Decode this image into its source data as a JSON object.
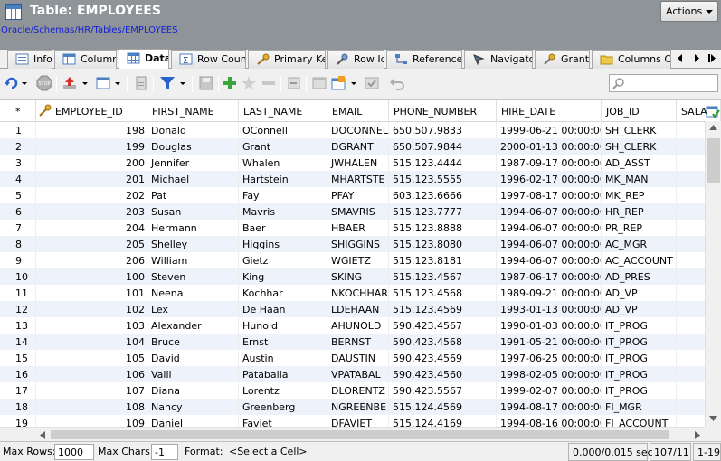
{
  "window": {
    "title": "Table: EMPLOYEES",
    "breadcrumb": "Oracle/Schemas/HR/Tables/EMPLOYEES",
    "actions_label": "Actions"
  },
  "tabs": [
    {
      "label": "Info",
      "icon": "info-icon"
    },
    {
      "label": "Columns",
      "icon": "columns-icon"
    },
    {
      "label": "Data",
      "icon": "data-grid-icon",
      "active": true
    },
    {
      "label": "Row Count",
      "icon": "sigma-icon"
    },
    {
      "label": "Primary Key",
      "icon": "key-icon"
    },
    {
      "label": "Row Id",
      "icon": "pin-icon"
    },
    {
      "label": "References",
      "icon": "references-icon"
    },
    {
      "label": "Navigator",
      "icon": "navigator-icon"
    },
    {
      "label": "Grants",
      "icon": "grants-icon"
    },
    {
      "label": "Columns Com",
      "icon": "folder-icon"
    }
  ],
  "toolbar": {
    "search_placeholder": ""
  },
  "grid": {
    "columns": [
      "*",
      "EMPLOYEE_ID",
      "FIRST_NAME",
      "LAST_NAME",
      "EMAIL",
      "PHONE_NUMBER",
      "HIRE_DATE",
      "JOB_ID",
      "SALA"
    ],
    "rows": [
      [
        "1",
        "198",
        "Donald",
        "OConnell",
        "DOCONNEL",
        "650.507.9833",
        "1999-06-21 00:00:00",
        "SH_CLERK"
      ],
      [
        "2",
        "199",
        "Douglas",
        "Grant",
        "DGRANT",
        "650.507.9844",
        "2000-01-13 00:00:00",
        "SH_CLERK"
      ],
      [
        "3",
        "200",
        "Jennifer",
        "Whalen",
        "JWHALEN",
        "515.123.4444",
        "1987-09-17 00:00:00",
        "AD_ASST"
      ],
      [
        "4",
        "201",
        "Michael",
        "Hartstein",
        "MHARTSTE",
        "515.123.5555",
        "1996-02-17 00:00:00",
        "MK_MAN"
      ],
      [
        "5",
        "202",
        "Pat",
        "Fay",
        "PFAY",
        "603.123.6666",
        "1997-08-17 00:00:00",
        "MK_REP"
      ],
      [
        "6",
        "203",
        "Susan",
        "Mavris",
        "SMAVRIS",
        "515.123.7777",
        "1994-06-07 00:00:00",
        "HR_REP"
      ],
      [
        "7",
        "204",
        "Hermann",
        "Baer",
        "HBAER",
        "515.123.8888",
        "1994-06-07 00:00:00",
        "PR_REP"
      ],
      [
        "8",
        "205",
        "Shelley",
        "Higgins",
        "SHIGGINS",
        "515.123.8080",
        "1994-06-07 00:00:00",
        "AC_MGR"
      ],
      [
        "9",
        "206",
        "William",
        "Gietz",
        "WGIETZ",
        "515.123.8181",
        "1994-06-07 00:00:00",
        "AC_ACCOUNT"
      ],
      [
        "10",
        "100",
        "Steven",
        "King",
        "SKING",
        "515.123.4567",
        "1987-06-17 00:00:00",
        "AD_PRES"
      ],
      [
        "11",
        "101",
        "Neena",
        "Kochhar",
        "NKOCHHAR",
        "515.123.4568",
        "1989-09-21 00:00:00",
        "AD_VP"
      ],
      [
        "12",
        "102",
        "Lex",
        "De Haan",
        "LDEHAAN",
        "515.123.4569",
        "1993-01-13 00:00:00",
        "AD_VP"
      ],
      [
        "13",
        "103",
        "Alexander",
        "Hunold",
        "AHUNOLD",
        "590.423.4567",
        "1990-01-03 00:00:00",
        "IT_PROG"
      ],
      [
        "14",
        "104",
        "Bruce",
        "Ernst",
        "BERNST",
        "590.423.4568",
        "1991-05-21 00:00:00",
        "IT_PROG"
      ],
      [
        "15",
        "105",
        "David",
        "Austin",
        "DAUSTIN",
        "590.423.4569",
        "1997-06-25 00:00:00",
        "IT_PROG"
      ],
      [
        "16",
        "106",
        "Valli",
        "Pataballa",
        "VPATABAL",
        "590.423.4560",
        "1998-02-05 00:00:00",
        "IT_PROG"
      ],
      [
        "17",
        "107",
        "Diana",
        "Lorentz",
        "DLORENTZ",
        "590.423.5567",
        "1999-02-07 00:00:00",
        "IT_PROG"
      ],
      [
        "18",
        "108",
        "Nancy",
        "Greenberg",
        "NGREENBE",
        "515.124.4569",
        "1994-08-17 00:00:00",
        "FI_MGR"
      ],
      [
        "19",
        "109",
        "Daniel",
        "Faviet",
        "DFAVIET",
        "515.124.4169",
        "1994-08-16 00:00:00",
        "FI_ACCOUNT"
      ]
    ]
  },
  "statusbar": {
    "max_rows_label": "Max Rows:",
    "max_rows_value": "1000",
    "max_chars_label": "Max Chars:",
    "max_chars_value": "-1",
    "format_label": "Format:",
    "format_value": "<Select a Cell>",
    "timing": "0.000/0.015 sec",
    "row_count": "107/11",
    "range": "1-19"
  }
}
